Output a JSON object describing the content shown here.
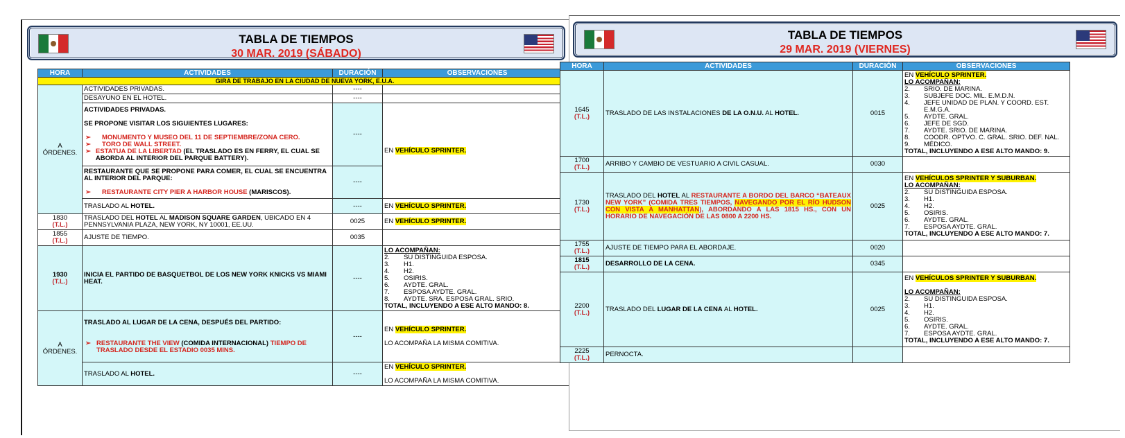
{
  "left": {
    "title": "TABLA DE TIEMPOS",
    "date": "30 MAR. 2019 (SÁBADO)",
    "headers": [
      "HORA",
      "ACTIVIDADES",
      "DURACIÓN",
      "OBSERVACIONES"
    ],
    "gira": "GIRA DE TRABAJO EN LA CIUDAD DE NUEVA YORK, E.U.A.",
    "r1_act": "ACTIVIDADES PRIVADAS.",
    "r1_dur": "----",
    "r2_act": "DESAYUNO EN EL HOTEL.",
    "r2_dur": "----",
    "hora_a_ordenes": "A",
    "hora_a_ordenes2": "ÓRDENES.",
    "r3_line1": "ACTIVIDADES PRIVADAS.",
    "r3_line2": "SE PROPONE VISITAR LOS SIGUIENTES LUGARES:",
    "bullet": "➢",
    "r3_b1": "MONUMENTO Y MUSEO DEL 11 DE SEPTIEMBRE/ZONA CERO.",
    "r3_b2": "TORO DE WALL STREET.",
    "r3_b3_red": "ESTATUA DE LA LIBERTAD",
    "r3_b3_rest": " (EL TRASLADO ES EN FERRY, EL CUAL SE ABORDA AL INTERIOR DEL PARQUE BATTERY).",
    "r3_dur": "----",
    "obs_en": "EN ",
    "obs_vehiculo": "VEHÍCULO SPRINTER.",
    "r4_line1": "RESTAURANTE QUE SE PROPONE PARA COMER, EL CUAL SE ENCUENTRA AL INTERIOR DEL PARQUE:",
    "r4_b1_red": "RESTAURANTE CITY PIER A HARBOR HOUSE",
    "r4_b1_rest": " (MARISCOS).",
    "r4_dur": "----",
    "r5_pre": "TRASLADO AL ",
    "r5_bold": "HOTEL.",
    "r5_dur": "----",
    "r6_hora": "1830",
    "r6_tl": "(T.L.)",
    "r6_pre": "TRASLADO DEL ",
    "r6_hotel": "HOTEL",
    "r6_mid": " AL ",
    "r6_msg": "MADISON SQUARE GARDEN",
    "r6_rest": ", UBICADO EN 4 PENNSYLVANIA PLAZA, NEW YORK, NY 10001, EE.UU.",
    "r6_dur": "0025",
    "r7_hora": "1855",
    "r7_tl": "(T.L.)",
    "r7_act": "AJUSTE DE TIEMPO.",
    "r7_dur": "0035",
    "r8_hora": "1930",
    "r8_tl": "(T.L.)",
    "r8_act": "INICIA EL PARTIDO DE BASQUETBOL DE LOS NEW YORK KNICKS VS MIAMI HEAT.",
    "r8_dur": "----",
    "r8_obs_head": "LO ACOMPAÑAN:",
    "r8_obs_items": [
      {
        "n": "2.",
        "t": "SU DISTINGUIDA ESPOSA."
      },
      {
        "n": "3.",
        "t": "H1."
      },
      {
        "n": "4.",
        "t": "H2."
      },
      {
        "n": "5.",
        "t": "OSIRIS."
      },
      {
        "n": "6.",
        "t": "AYDTE. GRAL."
      },
      {
        "n": "7.",
        "t": "ESPOSA AYDTE. GRAL."
      },
      {
        "n": "8.",
        "t": "AYDTE. SRA. ESPOSA GRAL. SRIO."
      }
    ],
    "r8_obs_total": "TOTAL, INCLUYENDO A ESE ALTO MANDO: 8.",
    "r9_line1": "TRASLADO AL LUGAR DE LA CENA, DESPUÉS DEL PARTIDO:",
    "r9_b1_red": "RESTAURANTE THE VIEW",
    "r9_b1_mid": " (COMIDA INTERNACIONAL) ",
    "r9_b1_red2": "TIEMPO DE TRASLADO DESDE EL ESTADIO 0035 MINS.",
    "r9_dur": "----",
    "r9_obs2": "LO ACOMPAÑA LA MISMA COMITIVA.",
    "r10_pre": "TRASLADO AL ",
    "r10_bold": "HOTEL.",
    "r10_dur": "----",
    "r10_obs2": "LO ACOMPAÑA LA MISMA COMITIVA."
  },
  "right": {
    "title": "TABLA DE TIEMPOS",
    "date": "29 MAR. 2019 (VIERNES)",
    "headers": [
      "HORA",
      "ACTIVIDADES",
      "DURACIÓN",
      "OBSERVACIONES"
    ],
    "tl": "(T.L.)",
    "r1_hora": "1645",
    "r1_pre": "TRASLADO DE LAS INSTALACIONES ",
    "r1_onu": "DE LA O.N.U.",
    "r1_mid": " AL ",
    "r1_hotel": "HOTEL.",
    "r1_dur": "0015",
    "r1_obs_en": "EN ",
    "r1_obs_veh": "VEHÍCULO SPRINTER.",
    "r1_obs_head": "LO ACOMPAÑAN:",
    "r1_obs_items": [
      {
        "n": "2.",
        "t": "SRIO. DE MARINA."
      },
      {
        "n": "3.",
        "t": "SUBJEFE DOC. MIL. E.M.D.N."
      },
      {
        "n": "4.",
        "t": "JEFE UNIDAD DE PLAN. Y COORD. EST. E.M.G.A."
      },
      {
        "n": "5.",
        "t": "AYDTE. GRAL."
      },
      {
        "n": "6.",
        "t": "JEFE DE SGD."
      },
      {
        "n": "7.",
        "t": "AYDTE. SRIO. DE MARINA."
      },
      {
        "n": "8.",
        "t": "COODR. OPTVO. C. GRAL. SRIO. DEF. NAL."
      },
      {
        "n": "9.",
        "t": "MÉDICO."
      }
    ],
    "r1_obs_total": "TOTAL, INCLUYENDO A ESE ALTO MANDO: 9.",
    "r2_hora": "1700",
    "r2_act": "ARRIBO Y CAMBIO DE VESTUARIO A CIVIL CASUAL.",
    "r2_dur": "0030",
    "r3_hora": "1730",
    "r3_pre": "TRASLADO DEL ",
    "r3_hotel": "HOTEL",
    "r3_mid": " AL ",
    "r3_red1": "RESTAURANTE A BORDO DEL BARCO “BATEAUX NEW YORK” (COMIDA TRES TIEMPOS, ",
    "r3_hl": "NAVEGANDO POR EL RÍO HUDSON CON VISTA A MANHATTAN",
    "r3_red2": "), ABORDANDO A LAS 1815 HS., CON UN HORARIO DE NAVEGACIÓN DE LAS 0800 A 2200 HS.",
    "r3_dur": "0025",
    "r3_obs_en": "EN ",
    "r3_obs_veh": "VEHÍCULOS SPRINTER Y SUBURBAN.",
    "r3_obs_head": "LO ACOMPAÑAN:",
    "r3_obs_items": [
      {
        "n": "2.",
        "t": "SU DISTINGUIDA ESPOSA."
      },
      {
        "n": "3.",
        "t": "H1."
      },
      {
        "n": "4.",
        "t": "H2."
      },
      {
        "n": "5.",
        "t": "OSIRIS."
      },
      {
        "n": "6.",
        "t": "AYDTE. GRAL."
      },
      {
        "n": "7.",
        "t": "ESPOSA AYDTE. GRAL."
      }
    ],
    "r3_obs_total": "TOTAL, INCLUYENDO A ESE ALTO MANDO: 7.",
    "r4_hora": "1755",
    "r4_act": "AJUSTE DE TIEMPO PARA EL ABORDAJE.",
    "r4_dur": "0020",
    "r5_hora": "1815",
    "r5_act": "DESARROLLO DE LA CENA.",
    "r5_dur": "0345",
    "r6_hora": "2200",
    "r6_pre": "TRASLADO DEL ",
    "r6_lugar": "LUGAR DE LA CENA",
    "r6_mid": " AL ",
    "r6_hotel": "HOTEL.",
    "r6_dur": "0025",
    "r6_obs_en": "EN ",
    "r6_obs_veh": "VEHÍCULOS SPRINTER Y SUBURBAN.",
    "r6_obs_head": "LO ACOMPAÑAN:",
    "r6_obs_items": [
      {
        "n": "2.",
        "t": "SU DISTINGUIDA ESPOSA."
      },
      {
        "n": "3.",
        "t": "H1."
      },
      {
        "n": "4.",
        "t": "H2."
      },
      {
        "n": "5.",
        "t": "OSIRIS."
      },
      {
        "n": "6.",
        "t": "AYDTE. GRAL."
      },
      {
        "n": "7.",
        "t": "ESPOSA AYDTE. GRAL."
      }
    ],
    "r6_obs_total": "TOTAL, INCLUYENDO A ESE ALTO MANDO: 7.",
    "r7_hora": "2225",
    "r7_act": "PERNOCTA."
  },
  "colors": {
    "header_blue": "#3b9ad9",
    "cell_cyan": "#d4f7f9",
    "highlight_yellow": "#fff200",
    "accent_red": "#d5261f",
    "banner_navy": "#23395d"
  },
  "icons": [
    "mexico-flag-icon",
    "usa-flag-icon",
    "arrow-bullet-icon"
  ]
}
